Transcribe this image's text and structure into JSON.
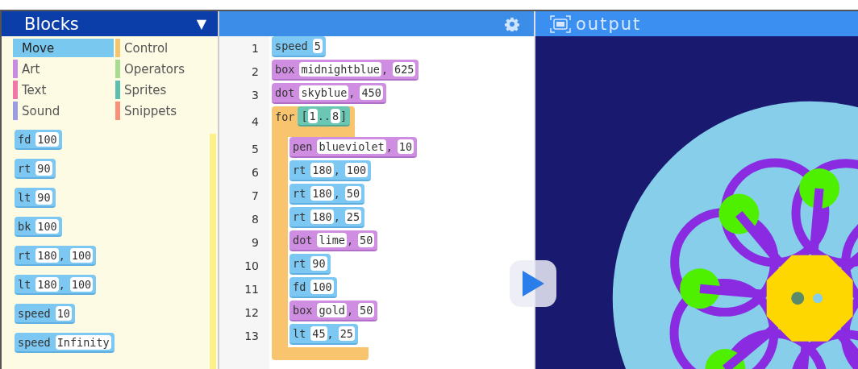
{
  "palette": {
    "title": "Blocks",
    "menu_glyph": "▼",
    "categories": [
      {
        "label": "Move",
        "color": "#78c8f0",
        "selected": true
      },
      {
        "label": "Control",
        "color": "#f8c46c",
        "selected": false
      },
      {
        "label": "Art",
        "color": "#c98be0",
        "selected": false
      },
      {
        "label": "Operators",
        "color": "#a8dc90",
        "selected": false
      },
      {
        "label": "Text",
        "color": "#f078a8",
        "selected": false
      },
      {
        "label": "Sprites",
        "color": "#5cc0b0",
        "selected": false
      },
      {
        "label": "Sound",
        "color": "#9c9ce0",
        "selected": false
      },
      {
        "label": "Snippets",
        "color": "#f8907a",
        "selected": false
      }
    ],
    "blocks": [
      {
        "kind": "move",
        "parts": [
          "fd",
          {
            "slot": "100"
          }
        ]
      },
      {
        "kind": "move",
        "parts": [
          "rt",
          {
            "slot": "90"
          }
        ]
      },
      {
        "kind": "move",
        "parts": [
          "lt",
          {
            "slot": "90"
          }
        ]
      },
      {
        "kind": "move",
        "parts": [
          "bk",
          {
            "slot": "100"
          }
        ]
      },
      {
        "kind": "move",
        "parts": [
          "rt",
          {
            "slot": "180"
          },
          ",",
          {
            "slot": "100"
          }
        ]
      },
      {
        "kind": "move",
        "parts": [
          "lt",
          {
            "slot": "180"
          },
          ",",
          {
            "slot": "100"
          }
        ]
      },
      {
        "kind": "move",
        "parts": [
          "speed",
          {
            "slot": "10"
          }
        ]
      },
      {
        "kind": "move",
        "parts": [
          "speed",
          {
            "slot": "Infinity"
          }
        ]
      }
    ]
  },
  "editor": {
    "code": [
      {
        "line": "1",
        "kind": "move",
        "parts": [
          "speed",
          {
            "slot": "5"
          }
        ]
      },
      {
        "line": "2",
        "kind": "art",
        "parts": [
          "box",
          {
            "slot": "midnightblue"
          },
          ",",
          {
            "slot": "625"
          }
        ]
      },
      {
        "line": "3",
        "kind": "art",
        "parts": [
          "dot",
          {
            "slot": "skyblue"
          },
          ",",
          {
            "slot": "450"
          }
        ]
      },
      {
        "line": "4",
        "kind": "control",
        "parts": [
          "for",
          {
            "kind": "list",
            "parts": [
              "[",
              {
                "slot": "1"
              },
              "..",
              {
                "slot": "8"
              },
              "]"
            ]
          }
        ],
        "children": [
          {
            "line": "5",
            "kind": "art",
            "parts": [
              "pen",
              {
                "slot": "blueviolet"
              },
              ",",
              {
                "slot": "10"
              }
            ]
          },
          {
            "line": "6",
            "kind": "move",
            "parts": [
              "rt",
              {
                "slot": "180"
              },
              ",",
              {
                "slot": "100"
              }
            ]
          },
          {
            "line": "7",
            "kind": "move",
            "parts": [
              "rt",
              {
                "slot": "180"
              },
              ",",
              {
                "slot": "50"
              }
            ]
          },
          {
            "line": "8",
            "kind": "move",
            "parts": [
              "rt",
              {
                "slot": "180"
              },
              ",",
              {
                "slot": "25"
              }
            ]
          },
          {
            "line": "9",
            "kind": "art",
            "parts": [
              "dot",
              {
                "slot": "lime"
              },
              ",",
              {
                "slot": "50"
              }
            ]
          },
          {
            "line": "10",
            "kind": "move",
            "parts": [
              "rt",
              {
                "slot": "90"
              }
            ]
          },
          {
            "line": "11",
            "kind": "move",
            "parts": [
              "fd",
              {
                "slot": "100"
              }
            ]
          },
          {
            "line": "12",
            "kind": "art",
            "parts": [
              "box",
              {
                "slot": "gold"
              },
              ",",
              {
                "slot": "50"
              }
            ]
          },
          {
            "line": "13",
            "kind": "move",
            "parts": [
              "lt",
              {
                "slot": "45"
              },
              ",",
              {
                "slot": "25"
              }
            ]
          }
        ]
      }
    ]
  },
  "output": {
    "title": "output"
  }
}
